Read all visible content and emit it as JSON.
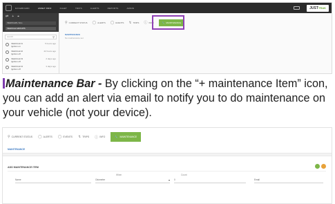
{
  "top_screenshot": {
    "nav": [
      "DASHBOARD",
      "ASSET INFO",
      "FLEET",
      "TRIPS",
      "ALERTS",
      "REPORTS",
      "ADMIN"
    ],
    "brand": {
      "main": "JUST",
      "accent": "TRAK"
    },
    "sidebar": {
      "icons": [
        "⇄",
        "+",
        "⌖"
      ],
      "rows": [
        "VEHICLES / ALL",
        "VEHICLE GROUPS"
      ],
      "search_placeholder": "search",
      "vehicles": [
        {
          "name": "VEHICLE 01",
          "detail": "Ignition on",
          "when": "5 hours ago"
        },
        {
          "name": "VEHICLE 02",
          "detail": "Ignition off",
          "when": "22 hours ago"
        },
        {
          "name": "VEHICLE 03",
          "detail": "Ignition off",
          "when": "2 days ago"
        },
        {
          "name": "VEHICLE 04",
          "detail": "Ignition off",
          "when": "3 days ago"
        }
      ]
    },
    "tabs": [
      "CURRENT STATUS",
      "ALERTS",
      "EVENTS",
      "TRIPS",
      "INFO"
    ],
    "maintenance_tab": "MAINTENANCE",
    "section_title": "MAINTENANCE",
    "section_subtitle": "No maintenance set"
  },
  "description": {
    "title": "Maintenance Bar -",
    "body": " By clicking on the “+ maintenance Item” icon, you can add an alert via email to notify you to do maintenance on your vehicle (not your device)."
  },
  "bottom_screenshot": {
    "tabs": [
      "CURRENT STATUS",
      "ALERTS",
      "EVENTS",
      "TRIPS",
      "INFO"
    ],
    "maintenance_tab": "MAINTENANCE",
    "section_title": "MAINTENANCE",
    "add_title": "ADD MAINTENANCE ITEM",
    "fields": {
      "name_placeholder": "Name",
      "when_label": "When",
      "when_value": "Odometer",
      "count_label": "Count",
      "count_value": "0",
      "email_placeholder": "Email"
    }
  },
  "colors": {
    "accent_green": "#7db648",
    "highlight": "#8e3fb5",
    "link_blue": "#3b79c2"
  }
}
